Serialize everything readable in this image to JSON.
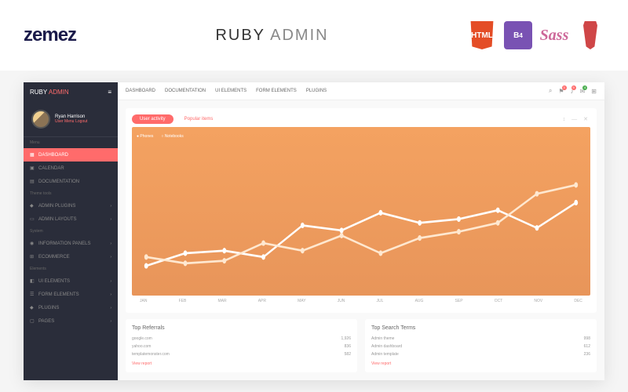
{
  "banner": {
    "logo": "zemez",
    "title_ruby": "RUBY",
    "title_admin": "ADMIN",
    "tech": {
      "html5": "HTML",
      "bootstrap": "B",
      "sass": "Sass",
      "gulp": "gulp"
    }
  },
  "sidebar": {
    "brand_ruby": "RUBY",
    "brand_admin": "ADMIN",
    "user": {
      "name": "Ryan Harrison",
      "menu_label": "User Menu",
      "logout": "Logout"
    },
    "sections": {
      "menu": "Menu",
      "theme": "Theme tools",
      "system": "System",
      "elements": "Elements"
    },
    "items": {
      "dashboard": "DASHBOARD",
      "calendar": "CALENDAR",
      "documentation": "DOCUMENTATION",
      "admin_plugins": "ADMIN PLUGINS",
      "admin_layouts": "ADMIN LAYOUTS",
      "info_panels": "INFORMATION PANELS",
      "ecommerce": "ECOMMERCE",
      "ui_elements": "UI ELEMENTS",
      "form_elements": "FORM ELEMENTS",
      "plugins": "PLUGINS",
      "pages": "PAGES"
    }
  },
  "topnav": {
    "dashboard": "DASHBOARD",
    "documentation": "DOCUMENTATION",
    "ui": "UI ELEMENTS",
    "form": "FORM ELEMENTS",
    "plugins": "PLUGINS",
    "badges": {
      "flag": "3",
      "bell": "9",
      "mail": "4"
    }
  },
  "chart": {
    "tab_activity": "User activity",
    "tab_popular": "Popular items",
    "legend_phones": "Phones",
    "legend_notebooks": "Notebooks"
  },
  "chart_data": {
    "type": "line",
    "categories": [
      "JAN",
      "FEB",
      "MAR",
      "APR",
      "MAY",
      "JUN",
      "JUL",
      "AUG",
      "SEP",
      "OCT",
      "NOV",
      "DEC"
    ],
    "series": [
      {
        "name": "Phones",
        "values": [
          18,
          28,
          30,
          25,
          50,
          46,
          60,
          52,
          55,
          62,
          48,
          68
        ]
      },
      {
        "name": "Notebooks",
        "values": [
          25,
          20,
          22,
          36,
          30,
          42,
          28,
          40,
          45,
          52,
          75,
          82
        ]
      }
    ],
    "ylim": [
      0,
      100
    ]
  },
  "referrals": {
    "title": "Top Referrals",
    "rows": [
      {
        "site": "google.com",
        "val": "1,926"
      },
      {
        "site": "yahoo.com",
        "val": "836"
      },
      {
        "site": "templatemonster.com",
        "val": "582"
      }
    ],
    "view": "View report"
  },
  "search_terms": {
    "title": "Top Search Terms",
    "rows": [
      {
        "term": "Admin theme",
        "val": "998"
      },
      {
        "term": "Admin dashboard",
        "val": "612"
      },
      {
        "term": "Admin template",
        "val": "236"
      }
    ],
    "view": "View report"
  }
}
